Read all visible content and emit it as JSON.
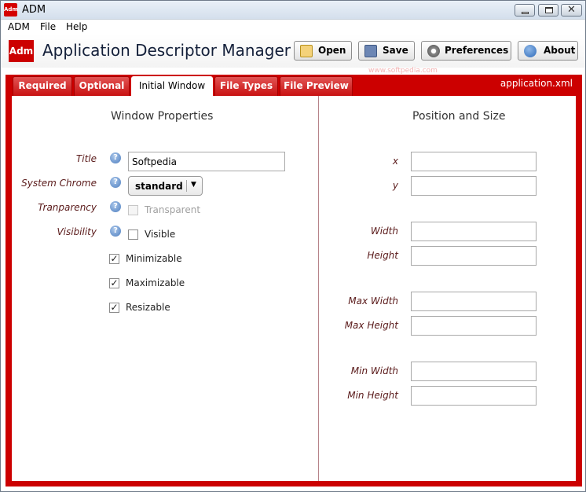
{
  "window": {
    "title": "ADM",
    "icon_text": "Adm",
    "minimize_icon": "minimize-icon",
    "maximize_icon": "maximize-icon",
    "close_glyph": "✕"
  },
  "menu": [
    "ADM",
    "File",
    "Help"
  ],
  "header": {
    "logo_text": "Adm",
    "app_title": "Application Descriptor Manager",
    "buttons": {
      "open": "Open",
      "save": "Save",
      "preferences": "Preferences",
      "about": "About"
    },
    "watermark": "www.softpedia.com"
  },
  "tabs": {
    "items": [
      "Required",
      "Optional",
      "Initial Window",
      "File Types",
      "File Preview"
    ],
    "active": "Initial Window",
    "file_name": "application.xml"
  },
  "window_properties": {
    "heading": "Window Properties",
    "title_label": "Title",
    "title_value": "Softpedia",
    "system_chrome_label": "System Chrome",
    "system_chrome_value": "standard",
    "transparency_label": "Tranparency",
    "transparent_label": "Transparent",
    "transparent_checked": false,
    "transparent_enabled": false,
    "visibility_label": "Visibility",
    "visible_label": "Visible",
    "visible_checked": false,
    "minimizable_label": "Minimizable",
    "minimizable_checked": true,
    "maximizable_label": "Maximizable",
    "maximizable_checked": true,
    "resizable_label": "Resizable",
    "resizable_checked": true,
    "help_glyph": "?"
  },
  "position_size": {
    "heading": "Position and Size",
    "fields": [
      {
        "label": "x",
        "value": ""
      },
      {
        "label": "y",
        "value": ""
      },
      {
        "label": "Width",
        "value": ""
      },
      {
        "label": "Height",
        "value": ""
      },
      {
        "label": "Max Width",
        "value": ""
      },
      {
        "label": "Max Height",
        "value": ""
      },
      {
        "label": "Min Width",
        "value": ""
      },
      {
        "label": "Min Height",
        "value": ""
      }
    ]
  },
  "colors": {
    "accent_red": "#cc0000",
    "label_color": "#5a1a1a"
  }
}
